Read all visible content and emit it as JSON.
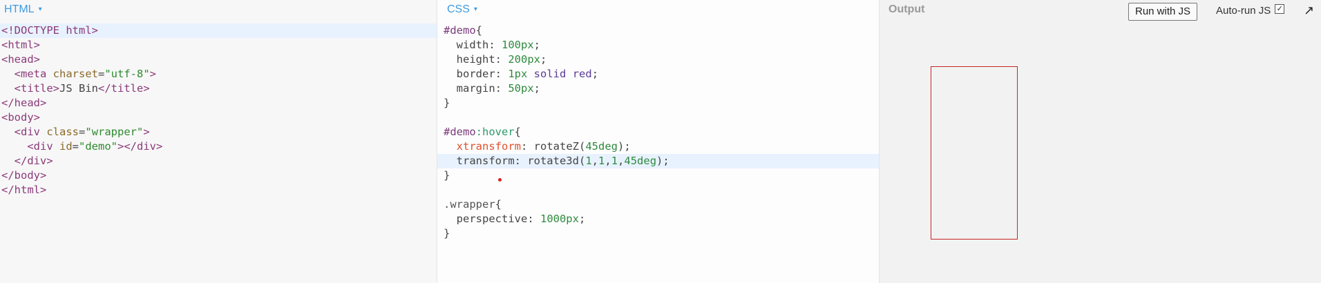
{
  "panels": {
    "html": {
      "label": "HTML",
      "caret": "▾"
    },
    "css": {
      "label": "CSS",
      "caret": "▾"
    },
    "output": {
      "label": "Output"
    }
  },
  "toolbar": {
    "run_label": "Run with JS",
    "autorun_label": "Auto-run JS",
    "autorun_checked": "✓",
    "expand_icon": "↗"
  },
  "html_code": [
    [
      [
        "tag",
        "<!DOCTYPE html>"
      ]
    ],
    [
      [
        "tag",
        "<html>"
      ]
    ],
    [
      [
        "tag",
        "<head>"
      ]
    ],
    [
      [
        "plain",
        "  "
      ],
      [
        "tag",
        "<meta "
      ],
      [
        "attr",
        "charset"
      ],
      [
        "plain",
        "="
      ],
      [
        "str",
        "\"utf-8\""
      ],
      [
        "tag",
        ">"
      ]
    ],
    [
      [
        "plain",
        "  "
      ],
      [
        "tag",
        "<title>"
      ],
      [
        "plain",
        "JS Bin"
      ],
      [
        "tag",
        "</title>"
      ]
    ],
    [
      [
        "tag",
        "</head>"
      ]
    ],
    [
      [
        "tag",
        "<body>"
      ]
    ],
    [
      [
        "plain",
        "  "
      ],
      [
        "tag",
        "<div "
      ],
      [
        "attr",
        "class"
      ],
      [
        "plain",
        "="
      ],
      [
        "str",
        "\"wrapper\""
      ],
      [
        "tag",
        ">"
      ]
    ],
    [
      [
        "plain",
        "    "
      ],
      [
        "tag",
        "<div "
      ],
      [
        "attr",
        "id"
      ],
      [
        "plain",
        "="
      ],
      [
        "str",
        "\"demo\""
      ],
      [
        "tag",
        "></div>"
      ]
    ],
    [
      [
        "plain",
        "  "
      ],
      [
        "tag",
        "</div>"
      ]
    ],
    [
      [
        "tag",
        "</body>"
      ]
    ],
    [
      [
        "tag",
        "</html>"
      ]
    ]
  ],
  "css_code": [
    [
      [
        "idsel",
        "#demo"
      ],
      [
        "plain",
        "{"
      ]
    ],
    [
      [
        "plain",
        "  width: "
      ],
      [
        "num",
        "100px"
      ],
      [
        "plain",
        ";"
      ]
    ],
    [
      [
        "plain",
        "  height: "
      ],
      [
        "num",
        "200px"
      ],
      [
        "plain",
        ";"
      ]
    ],
    [
      [
        "plain",
        "  border: "
      ],
      [
        "num",
        "1px"
      ],
      [
        "plain",
        " "
      ],
      [
        "kw",
        "solid"
      ],
      [
        "plain",
        " "
      ],
      [
        "kw",
        "red"
      ],
      [
        "plain",
        ";"
      ]
    ],
    [
      [
        "plain",
        "  margin: "
      ],
      [
        "num",
        "50px"
      ],
      [
        "plain",
        ";"
      ]
    ],
    [
      [
        "plain",
        "}"
      ]
    ],
    [
      [
        "plain",
        ""
      ]
    ],
    [
      [
        "idsel",
        "#demo"
      ],
      [
        "pseudo",
        ":hover"
      ],
      [
        "plain",
        "{"
      ]
    ],
    [
      [
        "plain",
        "  "
      ],
      [
        "err",
        "xtransform"
      ],
      [
        "plain",
        ": rotateZ("
      ],
      [
        "num",
        "45deg"
      ],
      [
        "plain",
        ");"
      ]
    ],
    [
      [
        "plain",
        "  transform: rotate3d("
      ],
      [
        "num",
        "1"
      ],
      [
        "plain",
        ","
      ],
      [
        "num",
        "1"
      ],
      [
        "plain",
        ","
      ],
      [
        "num",
        "1"
      ],
      [
        "plain",
        ","
      ],
      [
        "num",
        "45deg"
      ],
      [
        "plain",
        ");"
      ]
    ],
    [
      [
        "plain",
        "}"
      ]
    ],
    [
      [
        "plain",
        ""
      ]
    ],
    [
      [
        "cls",
        ".wrapper"
      ],
      [
        "plain",
        "{"
      ]
    ],
    [
      [
        "plain",
        "  perspective: "
      ],
      [
        "num",
        "1000px"
      ],
      [
        "plain",
        ";"
      ]
    ],
    [
      [
        "plain",
        "}"
      ]
    ]
  ]
}
